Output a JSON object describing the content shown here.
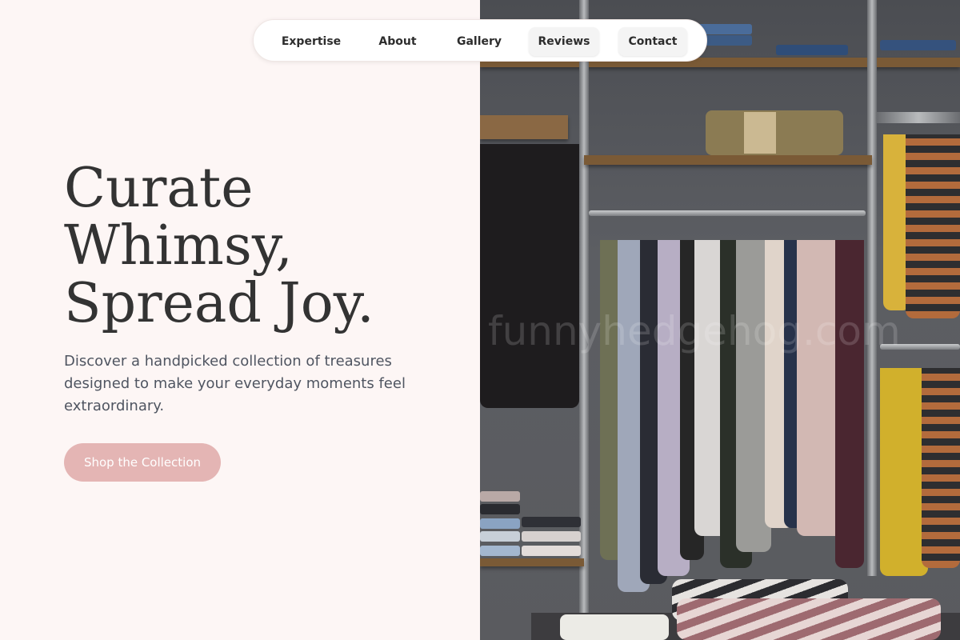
{
  "nav": {
    "items": [
      {
        "label": "Expertise"
      },
      {
        "label": "About"
      },
      {
        "label": "Gallery"
      },
      {
        "label": "Reviews"
      },
      {
        "label": "Contact"
      }
    ]
  },
  "hero": {
    "headline_lines": [
      "Curate",
      "Whimsy,",
      "Spread Joy."
    ],
    "subtext": "Discover a handpicked collection of treasures designed to make your everyday moments feel extraordinary.",
    "cta_label": "Shop the Collection"
  },
  "colors": {
    "background": "#fdf6f5",
    "cta": "#e4b5b4",
    "headline": "#333333",
    "body_text": "#4f5561"
  },
  "photo": {
    "watermark": "funnyhedgehog.com"
  }
}
